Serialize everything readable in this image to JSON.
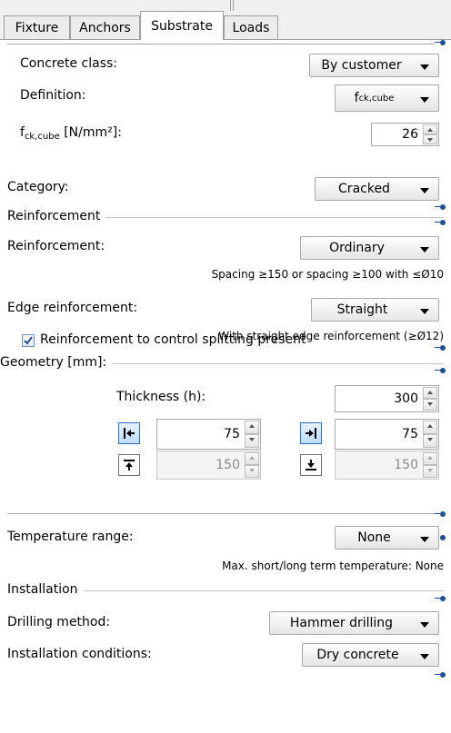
{
  "tabs": [
    {
      "label": "Fixture",
      "active": false
    },
    {
      "label": "Anchors",
      "active": false
    },
    {
      "label": "Substrate",
      "active": true
    },
    {
      "label": "Loads",
      "active": false
    }
  ],
  "concrete": {
    "class_label": "Concrete class:",
    "class_value": "By customer",
    "definition_label": "Definition:",
    "definition_value_main": "f",
    "definition_value_sub": "ck,cube",
    "fck_label_main": "f",
    "fck_label_sub": "ck,cube",
    "fck_label_unit": " [N/mm²]:",
    "fck_value": "26"
  },
  "category": {
    "label": "Category:",
    "value": "Cracked"
  },
  "reinforcement": {
    "group_title": "Reinforcement",
    "label": "Reinforcement:",
    "value": "Ordinary",
    "note": "Spacing ≥150 or spacing ≥100 with ≤Ø10",
    "edge_label": "Edge reinforcement:",
    "edge_value": "Straight",
    "edge_note": "With straight edge reinforcement (≥Ø12)",
    "splitting_label": "Reinforcement to control splitting present",
    "splitting_checked": true
  },
  "geometry": {
    "group_title": "Geometry [mm]:",
    "thickness_label": "Thickness (h):",
    "thickness_value": "300",
    "edge_left": "75",
    "edge_right": "75",
    "edge_top": "150",
    "edge_bottom": "150"
  },
  "temperature": {
    "label": "Temperature range:",
    "value": "None",
    "note": "Max. short/long term temperature: None"
  },
  "installation": {
    "group_title": "Installation",
    "drilling_label": "Drilling method:",
    "drilling_value": "Hammer drilling",
    "conditions_label": "Installation conditions:",
    "conditions_value": "Dry concrete"
  },
  "colors": {
    "accent": "#1e4f96",
    "icon_blue": "#2f6cc2"
  }
}
